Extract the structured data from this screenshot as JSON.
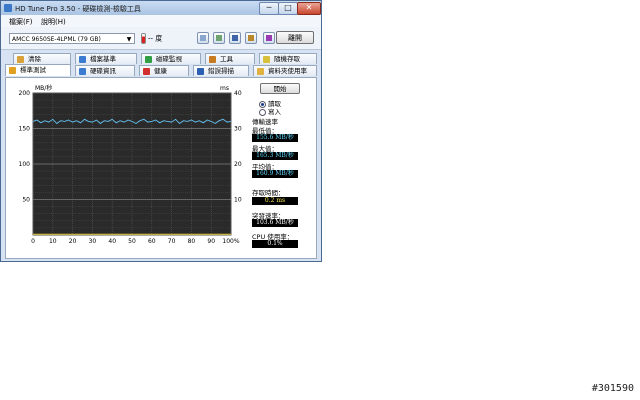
{
  "window": {
    "title": "HD Tune Pro 3.50 - 硬碟檢測-檢驗工具",
    "min_symbol": "─",
    "max_symbol": "□",
    "close_symbol": "✕"
  },
  "menu": {
    "items": [
      "檔案(F)",
      "說明(H)"
    ]
  },
  "toolbar": {
    "drive": "AMCC    9650SE-4LPML (79 GB)",
    "temperature": "-- 度",
    "icons": [
      "copy-text-icon",
      "copy-info-icon",
      "save-icon",
      "options-icon",
      "download-icon"
    ],
    "exit_label": "離開"
  },
  "tabs": {
    "row1": [
      {
        "label": "清除",
        "icon": "erase-icon",
        "color": "#d9a13a"
      },
      {
        "label": "檔案基準",
        "icon": "file-benchmark-icon",
        "color": "#3b7bd0"
      },
      {
        "label": "磁碟監視",
        "icon": "disk-monitor-icon",
        "color": "#2f9e44"
      },
      {
        "label": "工具",
        "icon": "tools-icon",
        "color": "#c77a20"
      },
      {
        "label": "隨機存取",
        "icon": "random-access-icon",
        "color": "#d9c03a"
      }
    ],
    "row2": [
      {
        "label": "標準測試",
        "icon": "benchmark-icon",
        "color": "#e0a020"
      },
      {
        "label": "硬碟資訊",
        "icon": "info-icon",
        "color": "#3b7bd0"
      },
      {
        "label": "健康",
        "icon": "health-icon",
        "color": "#d22f2f"
      },
      {
        "label": "錯誤掃描",
        "icon": "error-scan-icon",
        "color": "#2b5fb3"
      },
      {
        "label": "資料夾使用率",
        "icon": "folder-usage-icon",
        "color": "#e0b040"
      }
    ]
  },
  "side": {
    "start_label": "開始",
    "read_label": "讀取",
    "write_label": "寫入",
    "transfer_label": "傳輸速率",
    "min_label": "最低值：",
    "min_value": "155.6 MB/秒",
    "max_label": "最大值：",
    "max_value": "165.3 MB/秒",
    "avg_label": "平均值：",
    "avg_value": "160.9 MB/秒",
    "access_label": "存取時間：",
    "access_value": "0.2 ms",
    "burst_label": "突發速率：",
    "burst_value": "103.6 MB/秒",
    "cpu_label": "CPU 使用率：",
    "cpu_value": "0.1%"
  },
  "chart_data": {
    "type": "line",
    "ylabel_left": "MB/秒",
    "ylabel_right": "ms",
    "left_ticks": [
      "200",
      "150",
      "100",
      "50"
    ],
    "right_ticks": [
      "40",
      "30",
      "20",
      "10"
    ],
    "x_ticks": [
      "0",
      "10",
      "20",
      "30",
      "40",
      "50",
      "60",
      "70",
      "80",
      "90",
      "100%"
    ],
    "ylim": [
      0,
      200
    ],
    "ylim_right": [
      0,
      40
    ],
    "background": "#2a2a2a",
    "grid": true,
    "series": [
      {
        "name": "transfer",
        "color": "#62c0f0",
        "x": [
          0,
          2,
          4,
          6,
          8,
          10,
          12,
          14,
          16,
          18,
          20,
          22,
          24,
          26,
          28,
          30,
          32,
          34,
          36,
          38,
          40,
          42,
          44,
          46,
          48,
          50,
          52,
          54,
          56,
          58,
          60,
          62,
          64,
          66,
          68,
          70,
          72,
          74,
          76,
          78,
          80,
          82,
          84,
          86,
          88,
          90,
          92,
          94,
          96,
          98,
          100
        ],
        "values": [
          160,
          162,
          158,
          161,
          159,
          163,
          157,
          161,
          160,
          162,
          159,
          161,
          158,
          163,
          160,
          159,
          162,
          157,
          161,
          160,
          163,
          158,
          161,
          159,
          162,
          160,
          157,
          161,
          163,
          159,
          160,
          162,
          158,
          161,
          160,
          159,
          163,
          157,
          161,
          160,
          162,
          159,
          161,
          158,
          162,
          160,
          157,
          161,
          163,
          159,
          160
        ]
      },
      {
        "name": "access",
        "color": "#e6d13a",
        "x": [
          0,
          10,
          20,
          30,
          40,
          50,
          60,
          70,
          80,
          90,
          100
        ],
        "values": [
          0.2,
          0.2,
          0.2,
          0.2,
          0.2,
          0.2,
          0.2,
          0.2,
          0.2,
          0.2,
          0.2
        ]
      }
    ]
  },
  "watermark": "#301590"
}
